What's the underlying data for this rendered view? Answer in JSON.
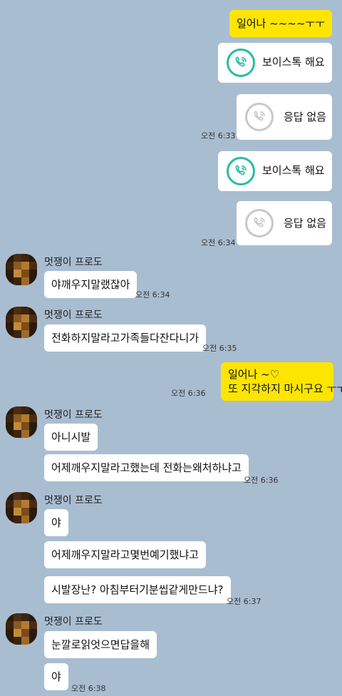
{
  "chat": {
    "m1": {
      "text": "일어나 ~~~~ㅜㅜ"
    },
    "m2": {
      "label": "보이스톡 해요",
      "icon": "phone-ringing-icon"
    },
    "m3": {
      "label": "응답 없음",
      "icon": "phone-missed-icon"
    },
    "t1": "오전 6:33",
    "m4": {
      "label": "보이스톡 해요",
      "icon": "phone-ringing-icon"
    },
    "m5": {
      "label": "응답 없음",
      "icon": "phone-missed-icon"
    },
    "t2": "오전 6:34",
    "g1": {
      "name": "멋쟁이 프로도",
      "msg": "야깨우지말랬잖아",
      "time": "오전 6:34"
    },
    "g2": {
      "name": "멋쟁이 프로도",
      "msg": "전화하지말라고가족들다잔다니가",
      "time": "오전 6:35"
    },
    "m6": {
      "line1": "일어나 ~♡",
      "line2": "또 지각하지 마시구요 ㅜㅜ",
      "time": "오전 6:36"
    },
    "g3": {
      "name": "멋쟁이 프로도",
      "msg1": "아니시발",
      "msg2": "어제깨우지말라고했는데 전화는왜처하냐고",
      "time": "오전 6:36"
    },
    "g4": {
      "name": "멋쟁이 프로도",
      "msg1": "야",
      "msg2": "어제깨우지말라고몇번예기했냐고",
      "msg3": "시발장난? 아침부터기분씹같게만드냐?",
      "time": "오전 6:37"
    },
    "g5": {
      "name": "멋쟁이 프로도",
      "msg1": "눈깔로읽엇으면답을해",
      "msg2": "야",
      "time": "오전 6:38"
    }
  },
  "colors": {
    "background": "#a9bdd1",
    "my_bubble": "#fee500",
    "other_bubble": "#ffffff",
    "call_green": "#28bba7",
    "call_gray": "#c8c8c8"
  }
}
